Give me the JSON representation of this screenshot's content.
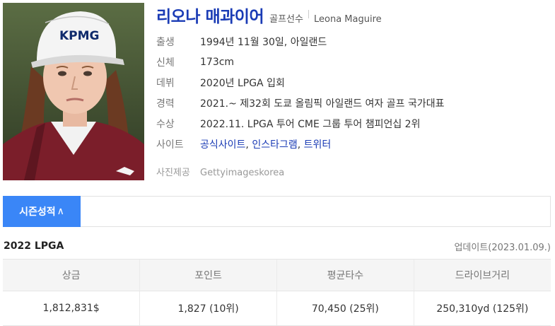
{
  "profile": {
    "name": "리오나 매과이어",
    "role": "골프선수",
    "name_en": "Leona Maguire",
    "rows": [
      {
        "label": "출생",
        "value": "1994년 11월 30일, 아일랜드"
      },
      {
        "label": "신체",
        "value": "173cm"
      },
      {
        "label": "데뷔",
        "value": "2020년 LPGA 입회"
      },
      {
        "label": "경력",
        "value": "2021.~ 제32회 도쿄 올림픽 아일랜드 여자 골프 국가대표"
      },
      {
        "label": "수상",
        "value": "2022.11. LPGA 투어 CME 그룹 투어 챔피언십 2위"
      }
    ],
    "site_label": "사이트",
    "sites": [
      "공식사이트",
      "인스타그램",
      "트위터"
    ],
    "site_separator": ", ",
    "credit_label": "사진제공",
    "credit_value": "Gettyimageskorea",
    "photo_cap_text": "KPMG"
  },
  "season": {
    "tab_label": "시즌성적",
    "tab_arrow": "∧"
  },
  "stats": {
    "title": "2022 LPGA",
    "updated": "업데이트(2023.01.09.)",
    "headers": [
      "상금",
      "포인트",
      "평균타수",
      "드라이브거리"
    ],
    "values": [
      "1,812,831$",
      "1,827 (10위)",
      "70,450 (25위)",
      "250,310yd (125위)"
    ]
  },
  "colors": {
    "name": "#1a3bb5",
    "link": "#1a3bb5",
    "tab": "#3a86f7",
    "table_header_bg": "#f5f5f5"
  }
}
